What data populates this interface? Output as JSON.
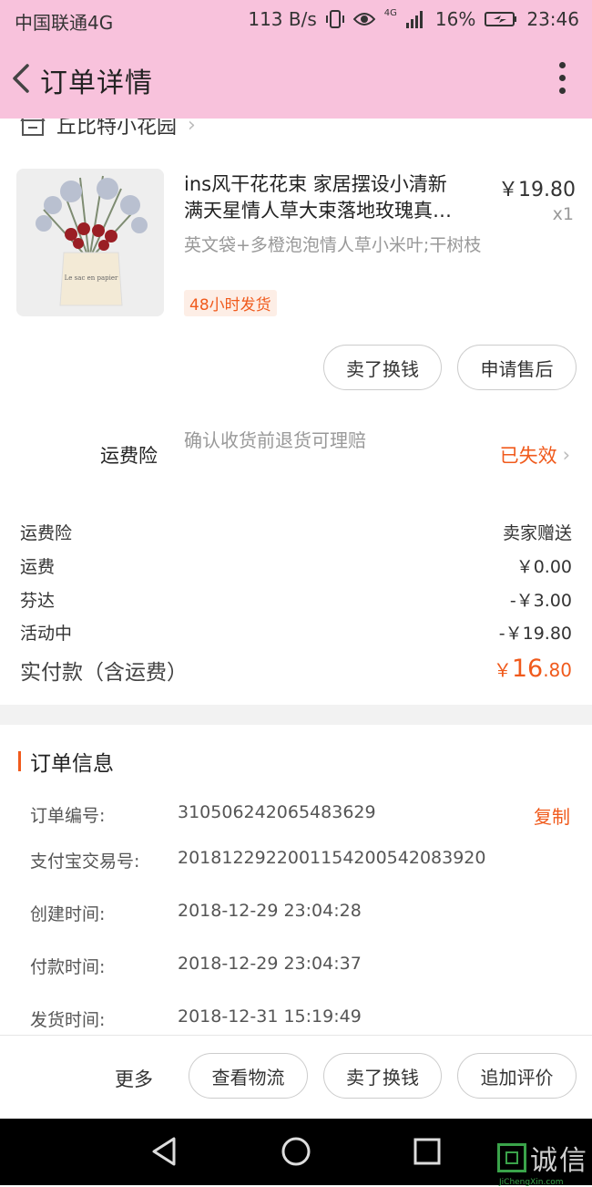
{
  "status_bar": {
    "carrier": "中国联通4G",
    "speed": "113 B/s",
    "battery": "16%",
    "time": "23:46",
    "network_small": "4G"
  },
  "header": {
    "title": "订单详情"
  },
  "store": {
    "name": "丘比特小花园"
  },
  "product": {
    "title_line1": "ins风干花花束 家居摆设小清新",
    "title_line2": "满天星情人草大束落地玫瑰真…",
    "price": "￥19.80",
    "qty": "x1",
    "sku": "英文袋+多橙泡泡情人草小米叶;干树枝",
    "tag": "48小时发货",
    "image_caption": "Le sac en papier"
  },
  "item_actions": {
    "sell_label": "卖了换钱",
    "aftersale_label": "申请售后"
  },
  "insurance": {
    "label": "运费险",
    "desc": "确认收货前退货可理赔",
    "status": "已失效"
  },
  "fees": [
    {
      "label": "运费险",
      "value": "卖家赠送"
    },
    {
      "label": "运费",
      "value": "￥0.00"
    },
    {
      "label": "芬达",
      "value": "-￥3.00"
    },
    {
      "label": "活动中",
      "value": "-￥19.80"
    }
  ],
  "total": {
    "label": "实付款（含运费）",
    "currency": "￥",
    "integer": "16",
    "decimal": ".80"
  },
  "order_info": {
    "title": "订单信息",
    "copy_label": "复制",
    "rows": [
      {
        "label": "订单编号:",
        "value": "310506242065483629"
      },
      {
        "label": "支付宝交易号:",
        "value": "2018122922001154200542083920"
      },
      {
        "label": "创建时间:",
        "value": "2018-12-29 23:04:28"
      },
      {
        "label": "付款时间:",
        "value": "2018-12-29 23:04:37"
      },
      {
        "label": "发货时间:",
        "value": "2018-12-31 15:19:49"
      }
    ]
  },
  "bottom_bar": {
    "more_label": "更多",
    "logistics_label": "查看物流",
    "sell_label": "卖了换钱",
    "review_label": "追加评价"
  },
  "watermark": {
    "text": "诚信",
    "sub": "JiChengXin.com"
  },
  "colors": {
    "header_bg": "#f8c2dc",
    "accent": "#f05a1c",
    "watermark_green": "#3aa34a"
  }
}
